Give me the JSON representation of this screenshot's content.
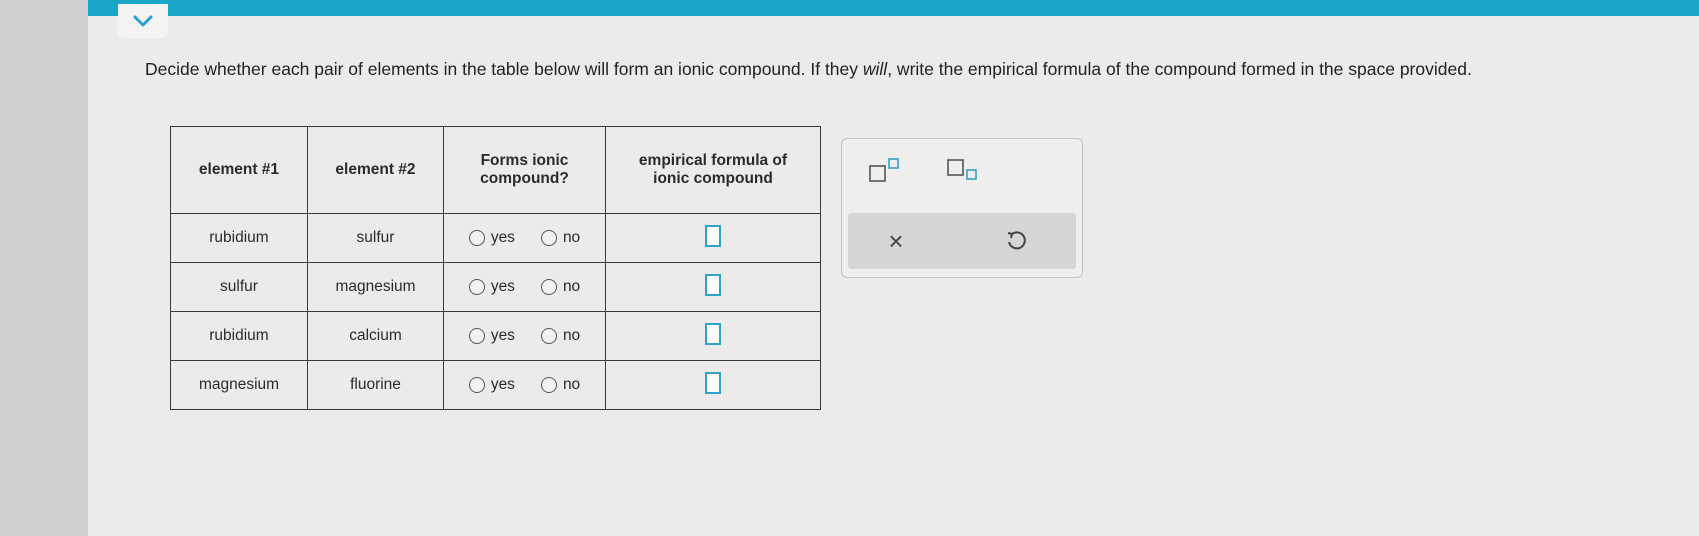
{
  "question": {
    "part1": "Decide whether each pair of elements in the table below will form an ionic compound. If they ",
    "emph": "will",
    "part2": ", write the empirical formula of the compound formed in the space provided."
  },
  "table": {
    "headers": {
      "element1": "element #1",
      "element2": "element #2",
      "forms_line1": "Forms ionic",
      "forms_line2": "compound?",
      "formula_line1": "empirical formula of",
      "formula_line2": "ionic compound"
    },
    "yes_label": "yes",
    "no_label": "no",
    "rows": [
      {
        "element1": "rubidium",
        "element2": "sulfur"
      },
      {
        "element1": "sulfur",
        "element2": "magnesium"
      },
      {
        "element1": "rubidium",
        "element2": "calcium"
      },
      {
        "element1": "magnesium",
        "element2": "fluorine"
      }
    ]
  },
  "tools": {
    "superscript": "superscript-icon",
    "subscript": "subscript-icon",
    "clear": "×",
    "undo": "undo-icon"
  },
  "colors": {
    "accent": "#1aa6c8",
    "answer_box": "#2fa4c9"
  }
}
